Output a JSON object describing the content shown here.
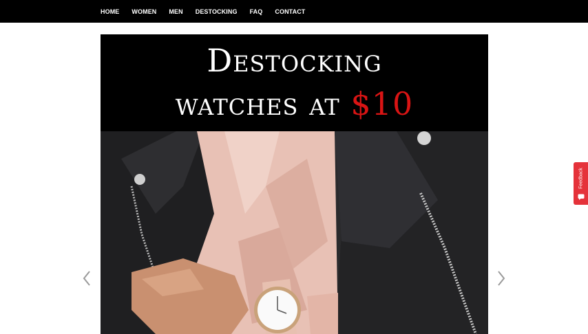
{
  "nav": {
    "items": [
      "HOME",
      "WOMEN",
      "MEN",
      "DESTOCKING",
      "FAQ",
      "CONTACT"
    ]
  },
  "banner": {
    "line1": "Destocking",
    "line2_prefix": "watches at ",
    "price": "$10"
  },
  "feedback": {
    "label": "Feedback"
  },
  "colors": {
    "nav_bg": "#000000",
    "accent_red": "#d91414",
    "feedback_bg": "#e5323a"
  },
  "icons": [
    "chevron-left-icon",
    "chevron-right-icon",
    "feedback-icon"
  ]
}
